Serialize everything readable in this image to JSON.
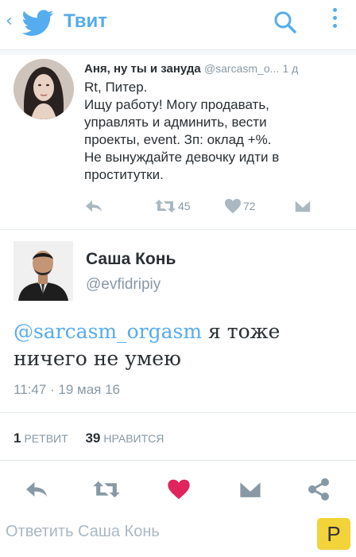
{
  "header": {
    "title": "Твит",
    "back_icon": "chevron-left-icon",
    "logo_icon": "twitter-bird-icon",
    "search_icon": "search-icon",
    "menu_icon": "more-vertical-icon",
    "accent_color": "#55acee"
  },
  "parent_tweet": {
    "author_name": "Аня, ну ты и зануда",
    "author_handle": "@sarcasm_o...",
    "time": "1 д",
    "text_lines": [
      "Rt, Питер.",
      "Ищу работу! Могу продавать,",
      "управлять и админить, вести",
      "проекты, event. Зп: оклад +%.",
      "Не вынуждайте девочку идти в",
      "проститутки."
    ],
    "retweet_count": "45",
    "like_count": "72"
  },
  "tweet": {
    "author_name": "Саша Конь",
    "author_handle": "@evfidripiy",
    "mention": "@sarcasm_orgasm",
    "text_rest_line1": " я тоже",
    "text_line2": "ничего не умею",
    "timestamp": "11:47 · 19 мая 16",
    "retweets_count": "1",
    "retweets_label": "РЕТВИТ",
    "likes_count": "39",
    "likes_label": "НРАВИТСЯ",
    "like_color": "#e0245e"
  },
  "reply": {
    "placeholder": "Ответить Саша Конь",
    "badge": "P"
  }
}
